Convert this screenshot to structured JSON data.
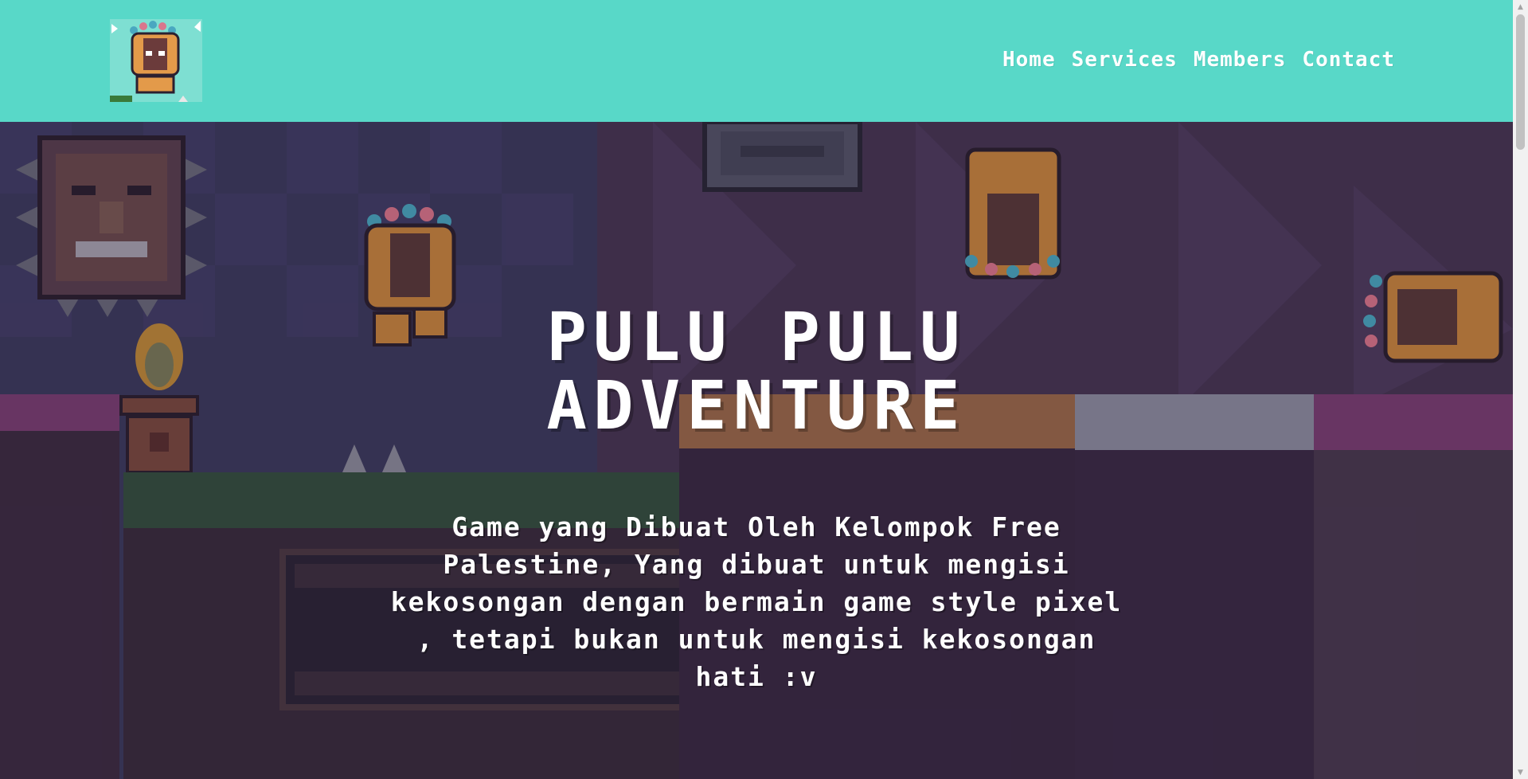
{
  "header": {
    "background_color": "#58d8c8",
    "logo_icon": "tiki-mask-character-logo"
  },
  "nav": {
    "items": [
      "Home",
      "Services",
      "Members",
      "Contact"
    ]
  },
  "hero": {
    "title": "PULU PULU ADVENTURE",
    "description": "Game yang Dibuat Oleh Kelompok Free Palestine, Yang dibuat untuk mengisi kekosongan dengan bermain game style pixel , tetapi bukan untuk mengisi kekosongan hati :v"
  },
  "colors": {
    "text": "#ffffff",
    "teal": "#58d8c8",
    "purple_ground": "#7a3f73",
    "sky_left": "#3e3d63",
    "sky_right": "#4a3858"
  }
}
